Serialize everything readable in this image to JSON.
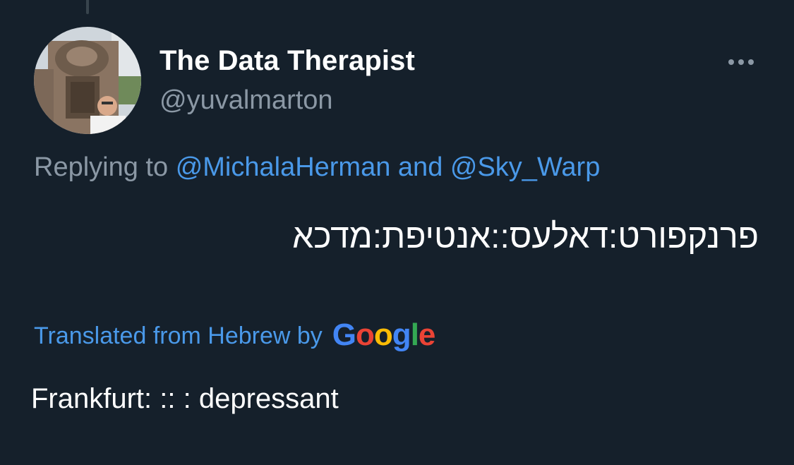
{
  "tweet": {
    "author": {
      "display_name": "The Data Therapist",
      "handle": "@yuvalmarton"
    },
    "replying_to": {
      "prefix": "Replying to",
      "mentions": [
        "@MichalaHerman",
        "@Sky_Warp"
      ],
      "conjunction": "and"
    },
    "text": "פרנקפורט:דאלעס::אנטיפת:מדכא",
    "translation": {
      "label": "Translated from Hebrew by",
      "provider_logo_text": "Google",
      "text": "Frankfurt: :: : depressant"
    },
    "more_icon": "more-horizontal-icon",
    "colors": {
      "background": "#15202b",
      "link": "#4a99e9",
      "secondary_text": "#8b98a5"
    }
  }
}
